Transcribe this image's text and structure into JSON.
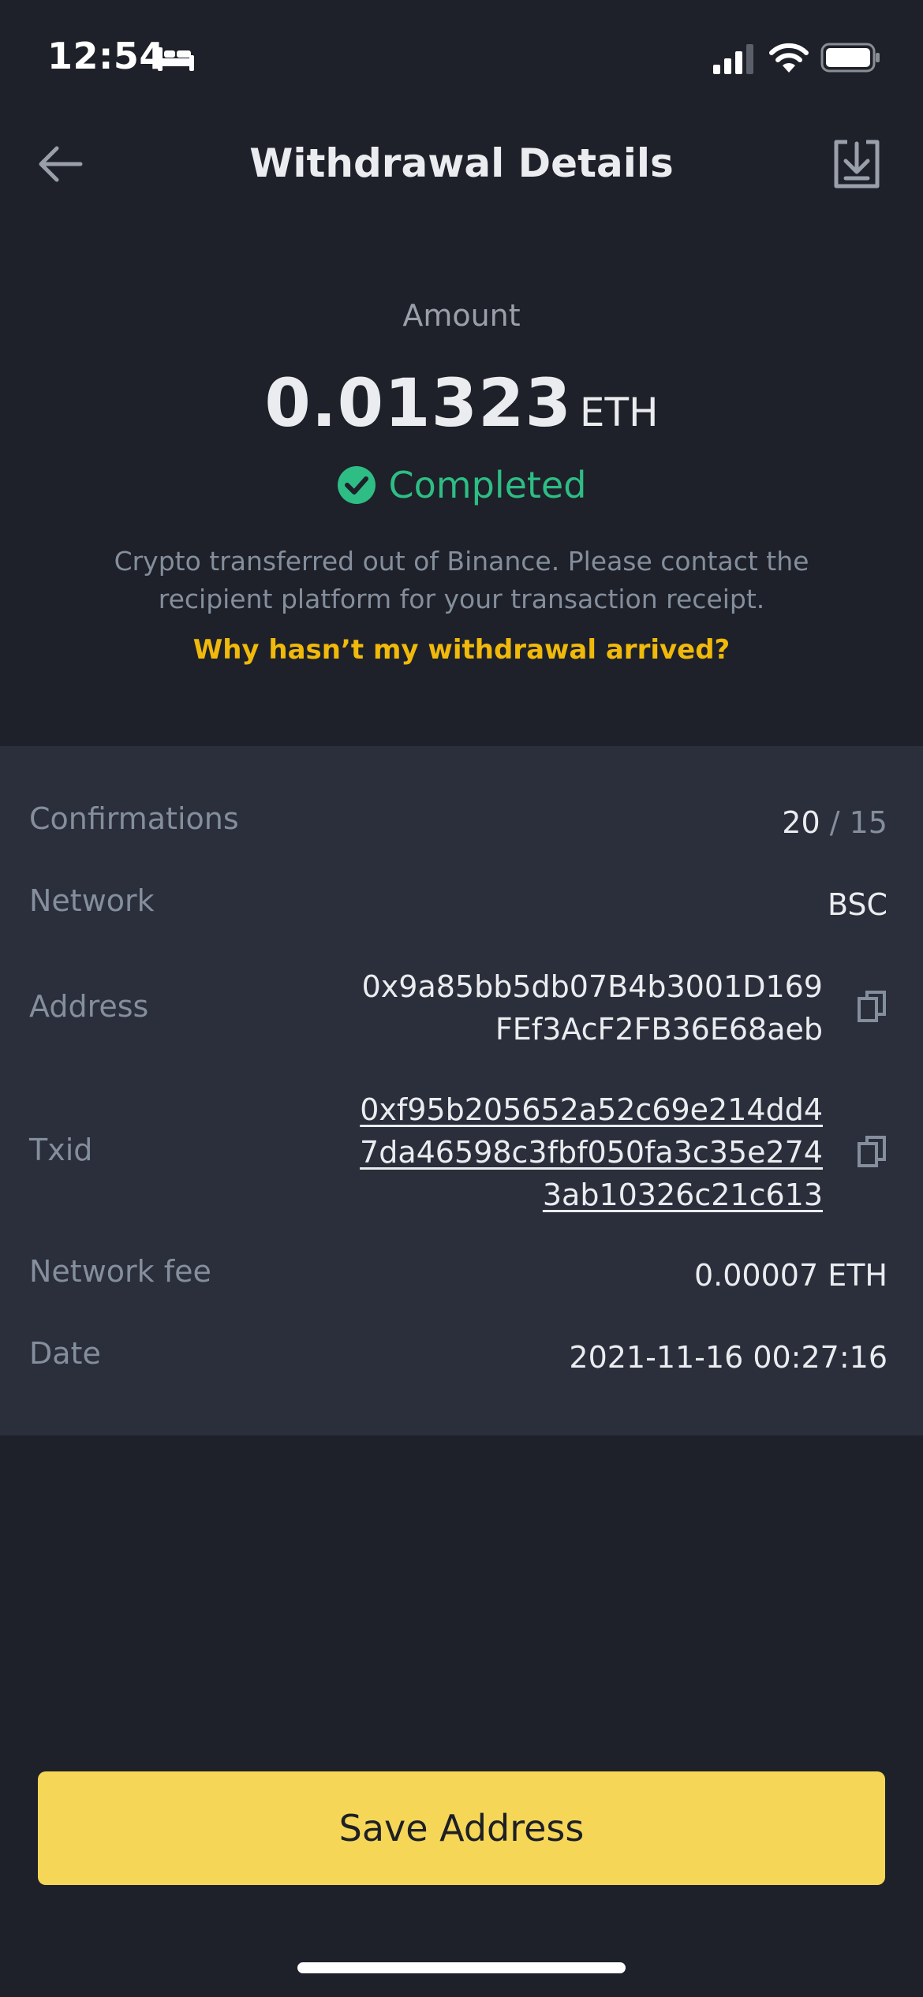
{
  "status_bar": {
    "time": "12:54"
  },
  "header": {
    "title": "Withdrawal Details"
  },
  "summary": {
    "amount_label": "Amount",
    "amount_value": "0.01323",
    "amount_unit": "ETH",
    "status": "Completed",
    "notice": "Crypto transferred out of Binance. Please contact the recipient platform for your transaction receipt.",
    "help_link": "Why hasn’t my withdrawal arrived?"
  },
  "details": {
    "confirmations_label": "Confirmations",
    "confirmations_current": "20",
    "confirmations_separator": "/ 15",
    "network_label": "Network",
    "network_value": "BSC",
    "address_label": "Address",
    "address_line1": "0x9a85bb5db07B4b3001D169",
    "address_line2": "FEf3AcF2FB36E68aeb",
    "txid_label": "Txid",
    "txid_line1": "0xf95b205652a52c69e214dd4",
    "txid_line2": "7da46598c3fbf050fa3c35e274",
    "txid_line3": "3ab10326c21c613",
    "fee_label": "Network fee",
    "fee_value": "0.00007 ETH",
    "date_label": "Date",
    "date_value": "2021-11-16 00:27:16"
  },
  "actions": {
    "save_address": "Save Address"
  },
  "colors": {
    "background": "#1e2129",
    "panel": "#2a2f3b",
    "accent_yellow": "#f0b90b",
    "button_yellow": "#f5d657",
    "success_green": "#2ebd85",
    "muted_text": "#848e9c"
  },
  "icons": {
    "back": "arrow-left-icon",
    "download": "download-icon",
    "status": "check-circle-icon",
    "copy": "copy-icon"
  }
}
